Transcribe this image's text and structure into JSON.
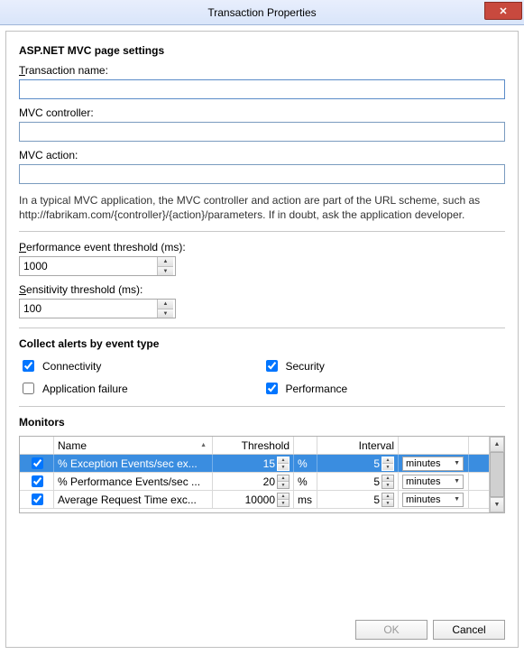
{
  "window": {
    "title": "Transaction Properties"
  },
  "section1": {
    "heading": "ASP.NET MVC page settings",
    "label_transaction": "Transaction name:",
    "value_transaction": "",
    "label_controller": "MVC controller:",
    "value_controller": "",
    "label_action": "MVC action:",
    "value_action": "",
    "description": "In a typical MVC application, the MVC controller and action are part of the URL scheme, such as http://fabrikam.com/{controller}/{action}/parameters. If in doubt, ask the application developer.",
    "label_perf_threshold": "Performance event threshold (ms):",
    "value_perf_threshold": "1000",
    "label_sens_threshold": "Sensitivity threshold (ms):",
    "value_sens_threshold": "100"
  },
  "section2": {
    "heading": "Collect alerts by event type",
    "connectivity_label": "Connectivity",
    "connectivity_checked": true,
    "security_label": "Security",
    "security_checked": true,
    "appfailure_label": "Application failure",
    "appfailure_checked": false,
    "performance_label": "Performance",
    "performance_checked": true
  },
  "monitors": {
    "heading": "Monitors",
    "col_name": "Name",
    "col_threshold": "Threshold",
    "col_interval": "Interval",
    "rows": [
      {
        "checked": true,
        "name": "% Exception Events/sec ex...",
        "threshold": "15",
        "thresh_unit": "%",
        "interval": "5",
        "interval_unit": "minutes",
        "selected": true
      },
      {
        "checked": true,
        "name": "% Performance Events/sec ...",
        "threshold": "20",
        "thresh_unit": "%",
        "interval": "5",
        "interval_unit": "minutes",
        "selected": false
      },
      {
        "checked": true,
        "name": "Average Request Time exc...",
        "threshold": "10000",
        "thresh_unit": "ms",
        "interval": "5",
        "interval_unit": "minutes",
        "selected": false
      }
    ]
  },
  "buttons": {
    "ok": "OK",
    "cancel": "Cancel"
  }
}
